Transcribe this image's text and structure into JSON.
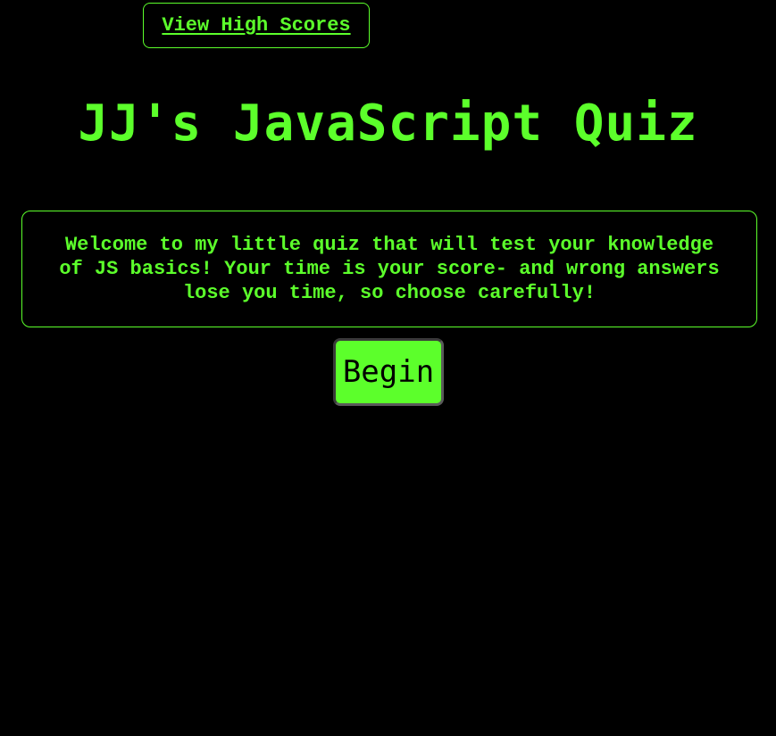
{
  "header": {
    "high_scores_link": "View High Scores"
  },
  "main": {
    "title": "JJ's JavaScript Quiz",
    "intro": "Welcome to my little quiz that will test your knowledge of JS basics! Your time is your score- and wrong answers lose you time, so choose carefully!",
    "begin_label": "Begin"
  },
  "colors": {
    "background": "#000000",
    "accent": "#5cff2b",
    "button_text": "#000000"
  }
}
